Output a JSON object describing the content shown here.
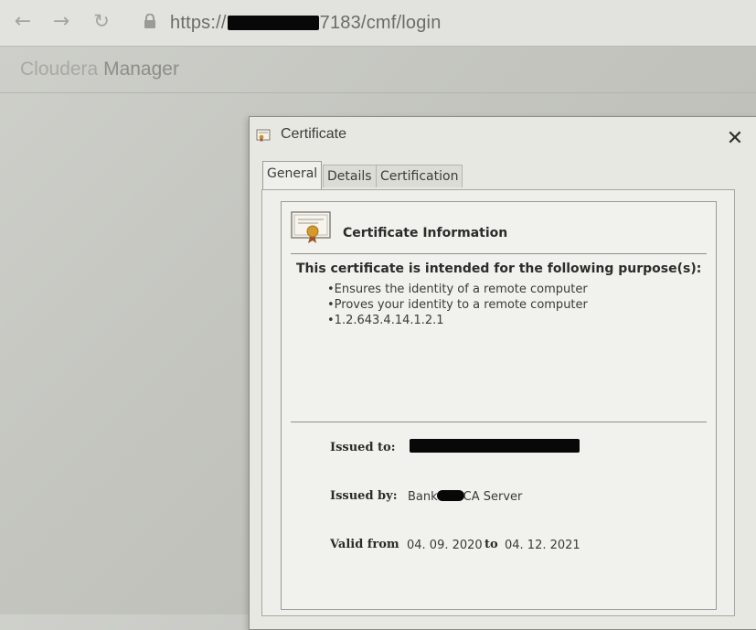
{
  "browser": {
    "back_icon": "arrow-left-icon",
    "forward_icon": "arrow-right-icon",
    "reload_icon": "reload-icon",
    "secure_icon": "lock-icon",
    "url_prefix": "https://",
    "url_suffix": "7183/cmf/login"
  },
  "page": {
    "app_title_first": "Cloudera",
    "app_title_second": "Manager"
  },
  "dialog": {
    "title": "Certificate",
    "close_glyph": "✕",
    "tabs": [
      {
        "label": "General",
        "active": true
      },
      {
        "label": "Details",
        "active": false
      },
      {
        "label": "Certification Path",
        "active": false
      }
    ],
    "info_title": "Certificate Information",
    "purpose_heading": "This certificate is intended for the following purpose(s):",
    "purposes": [
      "Ensures the identity of a remote computer",
      "Proves your identity to a remote computer",
      "1.2.643.4.14.1.2.1"
    ],
    "issued_to_label": "Issued to:",
    "issued_by_label": "Issued by:",
    "issued_by_prefix": "Bank",
    "issued_by_suffix": "CA Server",
    "valid_from_label": "Valid from",
    "valid_from": "04. 09. 2020",
    "to_label": "to",
    "valid_to": "04. 12. 2021"
  },
  "colors": {
    "redaction": "#080808",
    "dialog_bg": "#e8e8e3",
    "seal": "#d49a2e"
  }
}
